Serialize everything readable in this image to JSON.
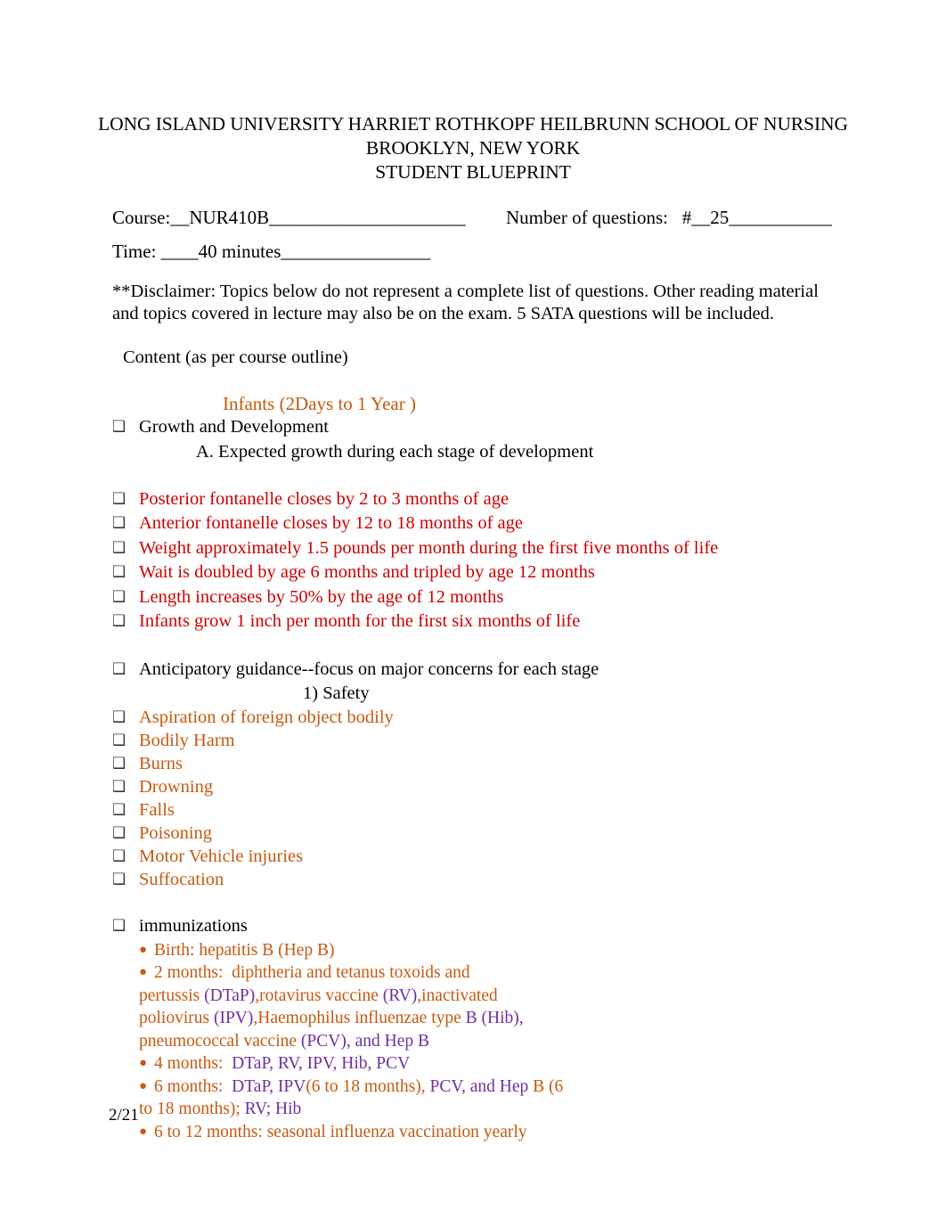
{
  "document": {
    "header": {
      "line1": "LONG ISLAND UNIVERSITY HARRIET ROTHKOPF HEILBRUNN SCHOOL OF NURSING",
      "line2": "BROOKLYN, NEW YORK",
      "line3": "STUDENT BLUEPRINT"
    },
    "meta": {
      "course_label": "Course:",
      "course_value": "__NUR410B_____________________",
      "questions_label": "Number of questions:",
      "questions_value": "#__25___________",
      "time_label": "Time:",
      "time_value": "____40 minutes________________"
    },
    "disclaimer": "**Disclaimer: Topics below do not represent a complete list of questions. Other reading material and topics covered in lecture may also be on the exam.     5 SATA questions will be included.",
    "content_heading": "Content (as per course outline)",
    "section_title": "Infants (2Days to 1 Year )",
    "growth": {
      "bullet_label": "Growth and Development",
      "sub_a": "A.   Expected growth during each stage of development"
    },
    "growth_points": [
      "Posterior fontanelle closes by 2 to 3 months of age",
      "Anterior fontanelle closes by 12 to 18 months of age",
      "Weight approximately 1.5 pounds per month during the first five months of life",
      "Wait is doubled by age 6 months and tripled by age 12 months",
      "Length increases by 50% by the age of 12 months",
      "Infants grow 1 inch per month for the first six months of life"
    ],
    "anticipatory": {
      "bullet_label": "Anticipatory guidance--focus on major concerns for each stage",
      "sub_1": "1)   Safety"
    },
    "safety_points": [
      "Aspiration of foreign object bodily",
      "Bodily Harm",
      "Burns",
      "Drowning",
      "Falls",
      "Poisoning",
      "Motor Vehicle injuries",
      "Suffocation"
    ],
    "immunizations": {
      "bullet_label": "immunizations",
      "dot": "●",
      "lines": [
        {
          "id": "birth",
          "segments": [
            {
              "text": " Birth: hepatitis B (Hep B)",
              "color": "orange"
            }
          ]
        },
        {
          "id": "two-months-a",
          "segments": [
            {
              "text": " 2 months:  diphtheria and tetanus toxoids and",
              "color": "orange"
            }
          ]
        },
        {
          "id": "two-months-b",
          "segments": [
            {
              "text": "pertussis ",
              "color": "orange"
            },
            {
              "text": "(DTaP)",
              "color": "purple"
            },
            {
              "text": ",rotavirus vaccine ",
              "color": "orange"
            },
            {
              "text": "(RV)",
              "color": "purple"
            },
            {
              "text": ",inactivated",
              "color": "orange"
            }
          ]
        },
        {
          "id": "two-months-c",
          "segments": [
            {
              "text": "poliovirus ",
              "color": "orange"
            },
            {
              "text": "(IPV)",
              "color": "purple"
            },
            {
              "text": ",Haemophilus influenzae type ",
              "color": "orange"
            },
            {
              "text": "B (Hib),",
              "color": "purple"
            }
          ]
        },
        {
          "id": "two-months-d",
          "segments": [
            {
              "text": "pneumococcal vaccine ",
              "color": "orange"
            },
            {
              "text": "(PCV), and Hep B",
              "color": "purple"
            }
          ]
        },
        {
          "id": "four-months",
          "segments": [
            {
              "text": " 4 months:  ",
              "color": "orange"
            },
            {
              "text": "DTaP, RV, IPV, Hib, PCV",
              "color": "purple"
            }
          ]
        },
        {
          "id": "six-months-a",
          "segments": [
            {
              "text": " 6 months:  ",
              "color": "orange"
            },
            {
              "text": "DTaP, IPV",
              "color": "purple"
            },
            {
              "text": "(6 to 18 months), ",
              "color": "orange"
            },
            {
              "text": "PCV, and Hep",
              "color": "purple"
            },
            {
              "text": " B (6",
              "color": "orange"
            }
          ]
        },
        {
          "id": "six-months-b",
          "segments": [
            {
              "text": "to 18 months); ",
              "color": "orange"
            },
            {
              "text": "RV; Hib",
              "color": "purple"
            }
          ]
        },
        {
          "id": "six-to-twelve",
          "segments": [
            {
              "text": " 6 to 12 months: seasonal influenza vaccination yearly",
              "color": "orange"
            }
          ]
        }
      ],
      "dot_lines": [
        "birth",
        "two-months-a",
        "four-months",
        "six-months-a",
        "six-to-twelve"
      ]
    },
    "footer": "2/21",
    "bullet_marker": "❑",
    "colors": {
      "red": "#CC0000",
      "orange": "#C55A11",
      "purple": "#7030A0",
      "black": "#000000"
    }
  }
}
